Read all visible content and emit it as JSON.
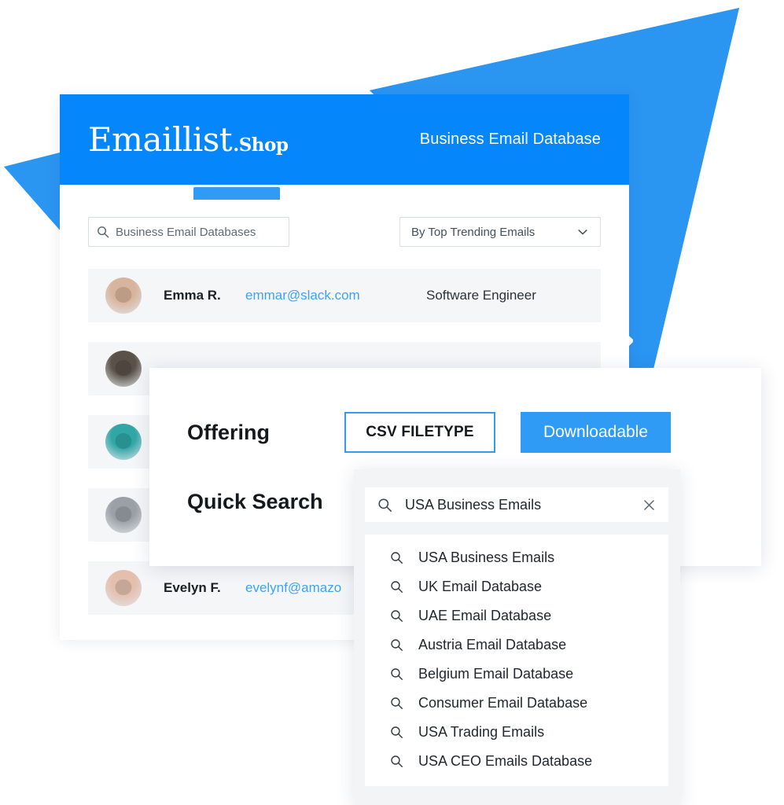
{
  "colors": {
    "header_blue": "#0586fa",
    "accent_blue": "#2f9bf5",
    "arrow_blue": "#2b95f2",
    "email_link": "#3fa2f7",
    "row_bg": "#f4f6f8",
    "panel_bg": "#f2f4f6"
  },
  "header": {
    "logo_main": "Emaillist",
    "logo_suffix": ".Shop",
    "tagline": "Business Email Database"
  },
  "filters": {
    "search_value": "Business Email Databases",
    "search_placeholder": "Business Email Databases",
    "search_icon": "search-icon",
    "sort_value": "By Top Trending Emails",
    "sort_icon": "chevron-down-icon"
  },
  "contacts": [
    {
      "name": "Emma R.",
      "email": "emmar@slack.com",
      "role": "Software Engineer",
      "avatar_tone": "#d8b49c",
      "visible": true
    },
    {
      "name": "",
      "email": "",
      "role": "",
      "avatar_tone": "#5a5148",
      "visible": false
    },
    {
      "name": "",
      "email": "",
      "role": "",
      "avatar_tone": "#30a6a6",
      "visible": false
    },
    {
      "name": "",
      "email": "",
      "role": "",
      "avatar_tone": "#9aa0a6",
      "visible": false
    },
    {
      "name": "Evelyn F.",
      "email": "evelynf@amazo",
      "role": "",
      "avatar_tone": "#e4bfae",
      "visible": true
    }
  ],
  "offering": {
    "label": "Offering",
    "csv_button": "CSV FILETYPE",
    "download_button": "Downloadable"
  },
  "quick_search": {
    "label": "Quick Search",
    "input_value": "USA Business Emails",
    "search_icon": "search-icon",
    "clear_icon": "close-icon",
    "suggestions": [
      "USA Business Emails",
      "UK Email Database",
      "UAE Email Database",
      "Austria Email Database",
      "Belgium Email Database",
      "Consumer Email Database",
      "USA Trading Emails",
      "USA CEO Emails Database"
    ]
  }
}
